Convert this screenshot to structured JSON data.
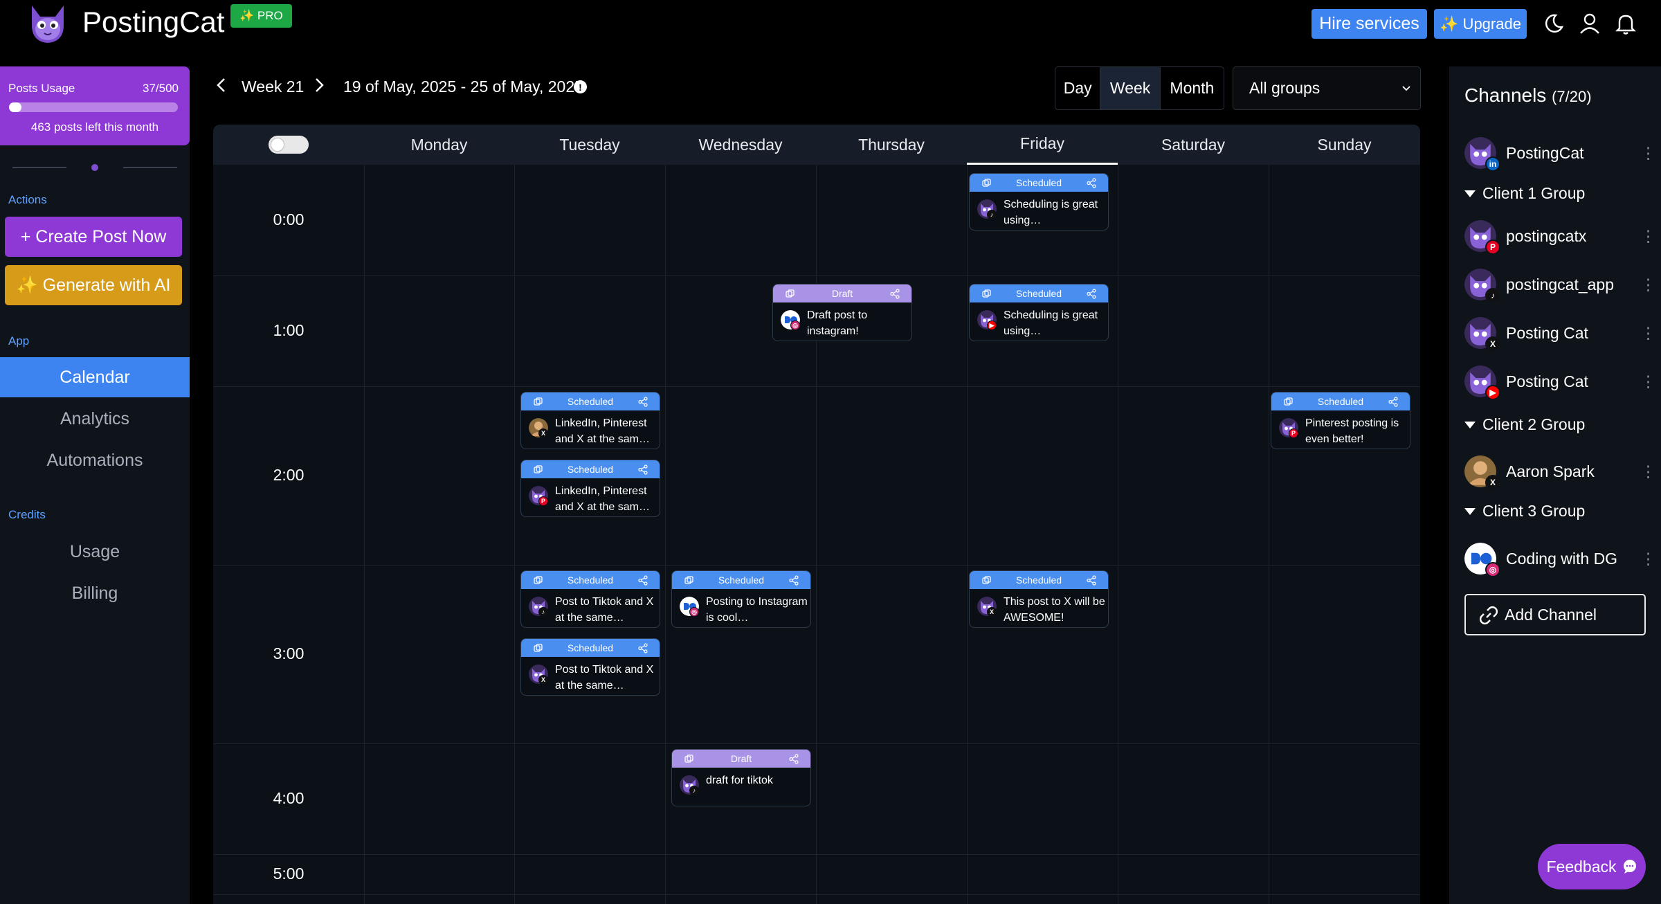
{
  "header": {
    "brand": "PostingCat",
    "pro_badge": "✨ PRO",
    "hire_button": "Hire services",
    "upgrade_button": "✨ Upgrade"
  },
  "sidebar": {
    "usage": {
      "title": "Posts Usage",
      "count": "37/500",
      "used_fraction": 0.074,
      "remaining": "463 posts left this month"
    },
    "actions_label": "Actions",
    "create_post": "+  Create Post Now",
    "generate_ai": "✨  Generate with AI",
    "app_label": "App",
    "nav": [
      "Calendar",
      "Analytics",
      "Automations"
    ],
    "credits_label": "Credits",
    "credits_nav": [
      "Usage",
      "Billing"
    ]
  },
  "toolbar": {
    "week_label": "Week 21",
    "date_range": "19 of May, 2025 - 25 of May, 2025",
    "info_icon": "!",
    "view_day": "Day",
    "view_week": "Week",
    "view_month": "Month",
    "group_select": "All groups"
  },
  "calendar": {
    "days": [
      "Monday",
      "Tuesday",
      "Wednesday",
      "Thursday",
      "Friday",
      "Saturday",
      "Sunday"
    ],
    "active_day": "Friday",
    "times": [
      "0:00",
      "1:00",
      "2:00",
      "3:00",
      "4:00",
      "5:00"
    ],
    "posts": [
      {
        "status": "Scheduled",
        "text": "Scheduling is great using…",
        "day": "Friday",
        "time": "0:00"
      },
      {
        "status": "Draft",
        "text": "Draft post to instagram!",
        "day": "Thursday",
        "time": "1:00"
      },
      {
        "status": "Scheduled",
        "text": "Scheduling is great using…",
        "day": "Friday",
        "time": "1:00"
      },
      {
        "status": "Scheduled",
        "text": "LinkedIn, Pinterest and X at the sam…",
        "day": "Tuesday",
        "time": "2:00"
      },
      {
        "status": "Scheduled",
        "text": "LinkedIn, Pinterest and X at the sam…",
        "day": "Tuesday",
        "time": "2:00"
      },
      {
        "status": "Scheduled",
        "text": "Pinterest posting is even better!",
        "day": "Sunday",
        "time": "2:00"
      },
      {
        "status": "Scheduled",
        "text": "Post to Tiktok and X at the same…",
        "day": "Tuesday",
        "time": "3:00"
      },
      {
        "status": "Scheduled",
        "text": "Post to Tiktok and X at the same…",
        "day": "Tuesday",
        "time": "3:00"
      },
      {
        "status": "Scheduled",
        "text": "Posting to Instagram is cool…",
        "day": "Wednesday",
        "time": "3:00"
      },
      {
        "status": "Scheduled",
        "text": "This post to X will be AWESOME!",
        "day": "Friday",
        "time": "3:00"
      },
      {
        "status": "Draft",
        "text": "draft for tiktok",
        "day": "Wednesday",
        "time": "4:00"
      }
    ]
  },
  "channels": {
    "title": "Channels",
    "count": "(7/20)",
    "items": [
      {
        "name": "PostingCat",
        "network": "linkedin"
      },
      {
        "group": "Client 1 Group"
      },
      {
        "name": "postingcatx",
        "network": "pinterest"
      },
      {
        "name": "postingcat_app",
        "network": "tiktok"
      },
      {
        "name": "Posting Cat",
        "network": "x"
      },
      {
        "name": "Posting Cat",
        "network": "youtube"
      },
      {
        "group": "Client 2 Group"
      },
      {
        "name": "Aaron Spark",
        "network": "x"
      },
      {
        "group": "Client 3 Group"
      },
      {
        "name": "Coding with DG",
        "network": "instagram"
      }
    ],
    "add_channel": "Add Channel",
    "menu_glyph": "⋮"
  },
  "feedback_button": "Feedback",
  "colors": {
    "accent_blue": "#3d84f0",
    "accent_purple": "#8e38d6",
    "ai_orange": "#d79b1a",
    "pro_green": "#1ea745",
    "draft_lavender": "#a893e6"
  }
}
